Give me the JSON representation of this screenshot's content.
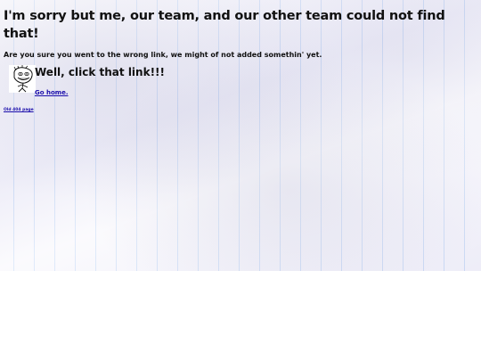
{
  "page": {
    "heading": "I'm sorry but me, our team, and our other team could not find that!",
    "subtitle": "Are you sure you went to the wrong link, we might of not added somethin' yet.",
    "section_title": "Well, click that link!!!",
    "home_link": "Go home.",
    "old_page_link": "Old 404 page",
    "meme_icon": "rage-face-icon"
  },
  "colors": {
    "background": "#f7f6fc",
    "rule_lines": "#96bef0",
    "link": "#1a0dab",
    "text": "#111111"
  }
}
